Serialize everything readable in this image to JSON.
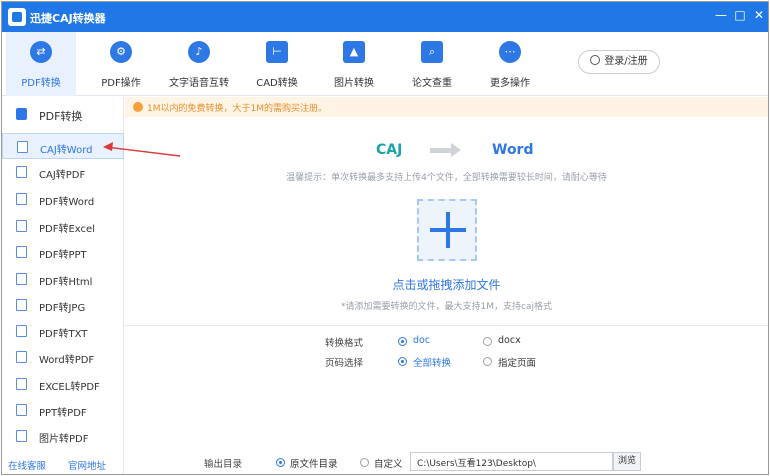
{
  "window": {
    "title": "迅捷CAJ转换器",
    "min_glyph": "—",
    "restore_glyph": "□",
    "close_glyph": "✕"
  },
  "toolbar": {
    "items": [
      {
        "label": "PDF转换",
        "icon": "swap-arrows-icon",
        "glyph": "⇄"
      },
      {
        "label": "PDF操作",
        "icon": "gear-icon",
        "glyph": "⚙"
      },
      {
        "label": "文字语音互转",
        "icon": "text-audio-icon",
        "glyph": "♪"
      },
      {
        "label": "CAD转换",
        "icon": "cad-icon",
        "glyph": "⊢"
      },
      {
        "label": "图片转换",
        "icon": "image-icon",
        "glyph": "▲"
      },
      {
        "label": "论文查重",
        "icon": "search-doc-icon",
        "glyph": "⌕"
      },
      {
        "label": "更多操作",
        "icon": "more-icon",
        "glyph": "⋯"
      }
    ],
    "login_label": "登录/注册"
  },
  "sidebar": {
    "header": "PDF转换",
    "items": [
      {
        "label": "CAJ转Word"
      },
      {
        "label": "CAJ转PDF"
      },
      {
        "label": "PDF转Word"
      },
      {
        "label": "PDF转Excel"
      },
      {
        "label": "PDF转PPT"
      },
      {
        "label": "PDF转Html"
      },
      {
        "label": "PDF转JPG"
      },
      {
        "label": "PDF转TXT"
      },
      {
        "label": "Word转PDF"
      },
      {
        "label": "EXCEL转PDF"
      },
      {
        "label": "PPT转PDF"
      },
      {
        "label": "图片转PDF"
      }
    ],
    "footer_service": "在线客服",
    "footer_site": "官网地址"
  },
  "main": {
    "notice": "1M以内的免费转换，大于1M的需购买注册。",
    "from_format": "CAJ",
    "to_format": "Word",
    "tip": "温馨提示：单次转换最多支持上传4个文件，全部转换需要较长时间，请耐心等待",
    "add_label": "点击或拖拽添加文件",
    "add_hint": "*请添加需要转换的文件，最大支持1M，支持caj格式"
  },
  "options": {
    "format_label": "转换格式",
    "format_doc": "doc",
    "format_docx": "docx",
    "page_label": "页码选择",
    "page_all": "全部转换",
    "page_specific": "指定页面"
  },
  "output": {
    "label": "输出目录",
    "original": "原文件目录",
    "custom": "自定义",
    "path": "C:\\Users\\互看123\\Desktop\\",
    "browse": "浏览"
  },
  "colors": {
    "accent": "#1f78e6",
    "caj": "#1ba3a8",
    "notice": "#e8902e",
    "annotation_arrow": "#d93a3a"
  }
}
